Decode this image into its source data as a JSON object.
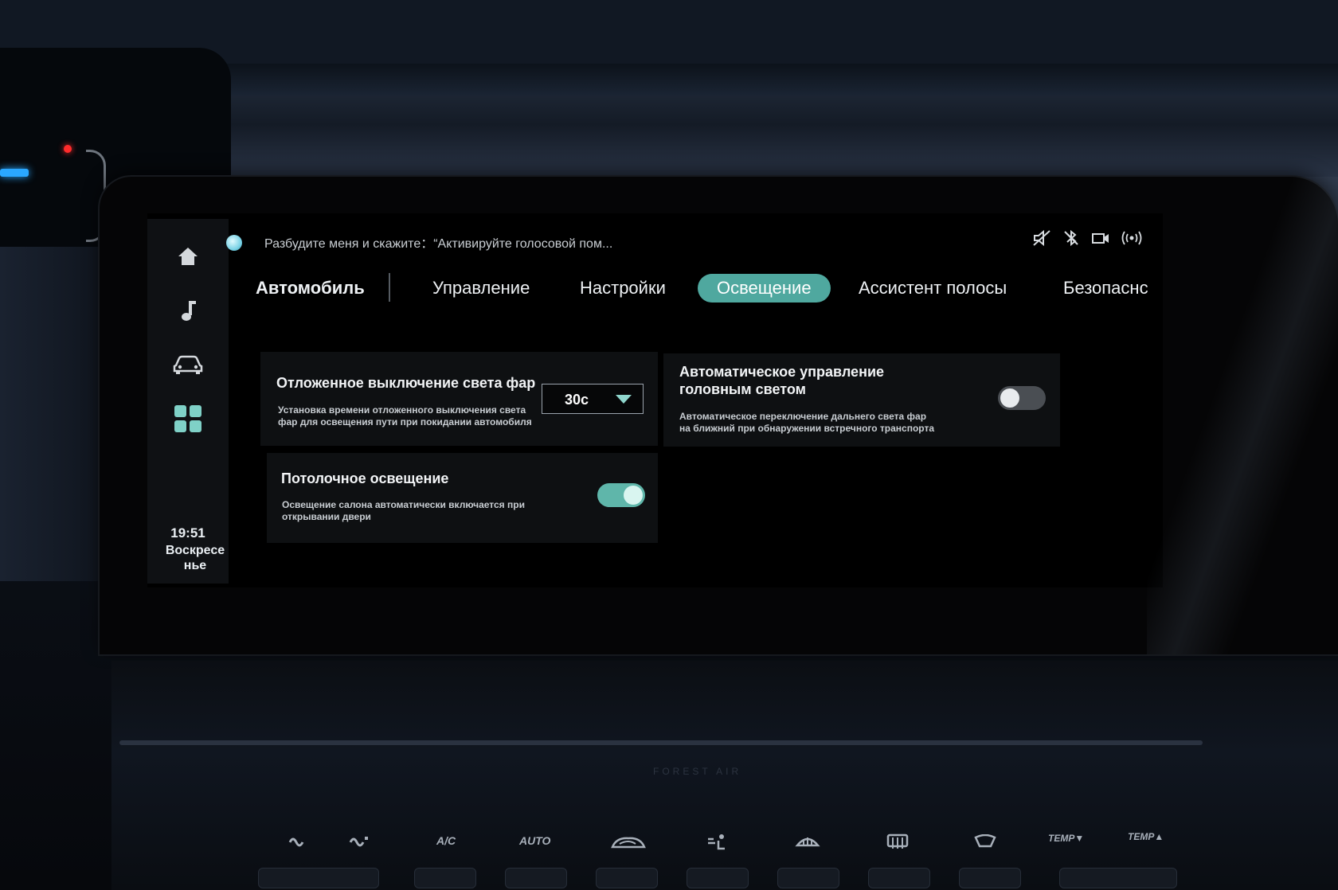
{
  "assistant": {
    "prompt": "Разбудите меня и скажите：“Активируйте голосовой пом..."
  },
  "status_icons": [
    "mute-icon",
    "bluetooth-off-icon",
    "camera-icon",
    "signal-icon"
  ],
  "sidebar": {
    "items": [
      {
        "icon": "home-icon"
      },
      {
        "icon": "music-icon"
      },
      {
        "icon": "car-icon"
      },
      {
        "icon": "apps-grid-icon"
      }
    ],
    "time": "19:51",
    "day_line1": "Воскресе",
    "day_line2": "нье"
  },
  "tabs": [
    {
      "label": "Автомобиль"
    },
    {
      "label": "Управление"
    },
    {
      "label": "Настройки"
    },
    {
      "label": "Освещение",
      "active": true
    },
    {
      "label": "Ассистент полосы"
    },
    {
      "label": "Безопаснс"
    }
  ],
  "cards": {
    "delayed_off": {
      "title": "Отложенное выключение света фар",
      "desc_line1": "Установка времени отложенного выключения света",
      "desc_line2": "фар для освещения пути при покидании автомобиля",
      "value": "30с"
    },
    "auto_headlight": {
      "title_line1": "Автоматическое управление",
      "title_line2": "головным светом",
      "desc_line1": "Автоматическое переключение дальнего света фар",
      "desc_line2": "на ближний при обнаружении встречного транспорта",
      "enabled": false
    },
    "ceiling_light": {
      "title": "Потолочное освещение",
      "desc_line1": "Освещение салона автоматически включается при",
      "desc_line2": "открывании двери",
      "enabled": true
    }
  },
  "console": {
    "brand": "FOREST AIR",
    "buttons": [
      "A/C",
      "AUTO",
      "TEMP▼",
      "TEMP▲"
    ]
  },
  "colors": {
    "accent": "#4fa89f",
    "card_bg": "#0e1012",
    "screen_bg": "#000000"
  }
}
